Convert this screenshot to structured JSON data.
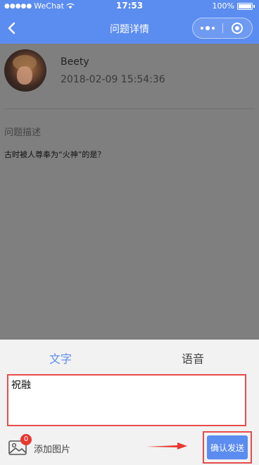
{
  "status_bar": {
    "carrier": "WeChat",
    "time": "17:53",
    "battery": "100%"
  },
  "nav": {
    "title": "问题详情"
  },
  "question": {
    "user_name": "Beety",
    "time": "2018-02-09 15:54:36",
    "section_label": "问题描述",
    "text": "古时被人尊奉为“火神”的是？"
  },
  "answer_panel": {
    "tabs": [
      {
        "label": "文字",
        "active": true
      },
      {
        "label": "语音",
        "active": false
      }
    ],
    "input_value": "祝融",
    "image_count": "0",
    "add_image_label": "添加图片",
    "send_label": "确认发送"
  },
  "colors": {
    "accent": "#5b8cf0",
    "highlight": "#e84b4b",
    "badge": "#e8382f"
  },
  "icons": {
    "back": "chevron-left-icon",
    "more": "more-dots-icon",
    "close": "target-close-icon",
    "image": "image-icon",
    "arrow": "arrow-right-icon"
  }
}
